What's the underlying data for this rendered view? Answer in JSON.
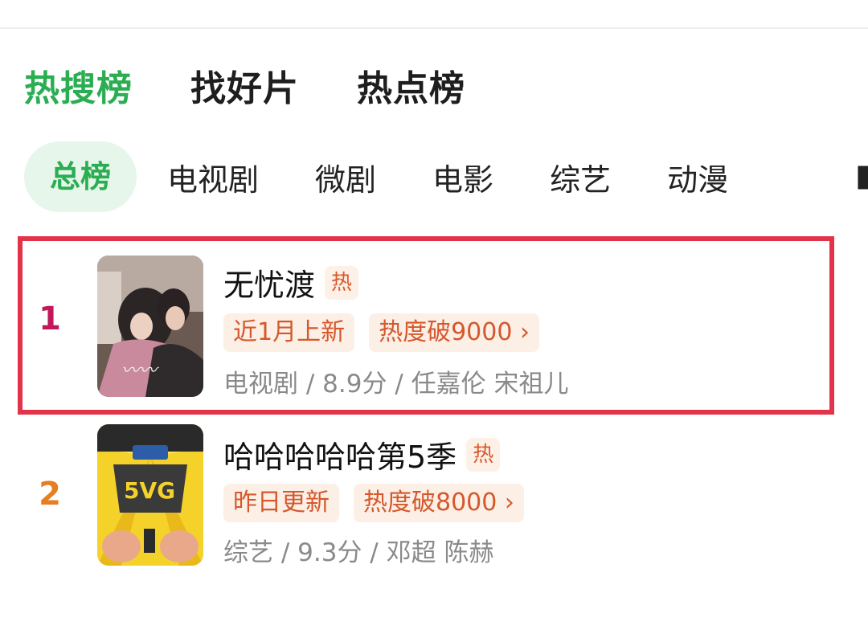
{
  "tabs": [
    {
      "label": "热搜榜",
      "active": true
    },
    {
      "label": "找好片",
      "active": false
    },
    {
      "label": "热点榜",
      "active": false
    }
  ],
  "categories": [
    {
      "label": "总榜",
      "active": true
    },
    {
      "label": "电视剧",
      "active": false
    },
    {
      "label": "微剧",
      "active": false
    },
    {
      "label": "电影",
      "active": false
    },
    {
      "label": "综艺",
      "active": false
    },
    {
      "label": "动漫",
      "active": false
    }
  ],
  "list": [
    {
      "rank": "1",
      "rank_color": "#c2185b",
      "title": "无忧渡",
      "badge": "热",
      "tag_new": "近1月上新",
      "tag_heat": "热度破9000 ›",
      "meta": "电视剧 / 8.9分 / 任嘉伦 宋祖儿",
      "highlighted": true
    },
    {
      "rank": "2",
      "rank_color": "#e67e22",
      "title": "哈哈哈哈哈第5季",
      "badge": "热",
      "tag_new": "昨日更新",
      "tag_heat": "热度破8000 ›",
      "meta": "综艺 / 9.3分 / 邓超 陈赫",
      "highlighted": false
    }
  ],
  "colors": {
    "accent_green": "#2aae51",
    "highlight_red": "#e2334a",
    "tag_orange": "#d5582c"
  }
}
